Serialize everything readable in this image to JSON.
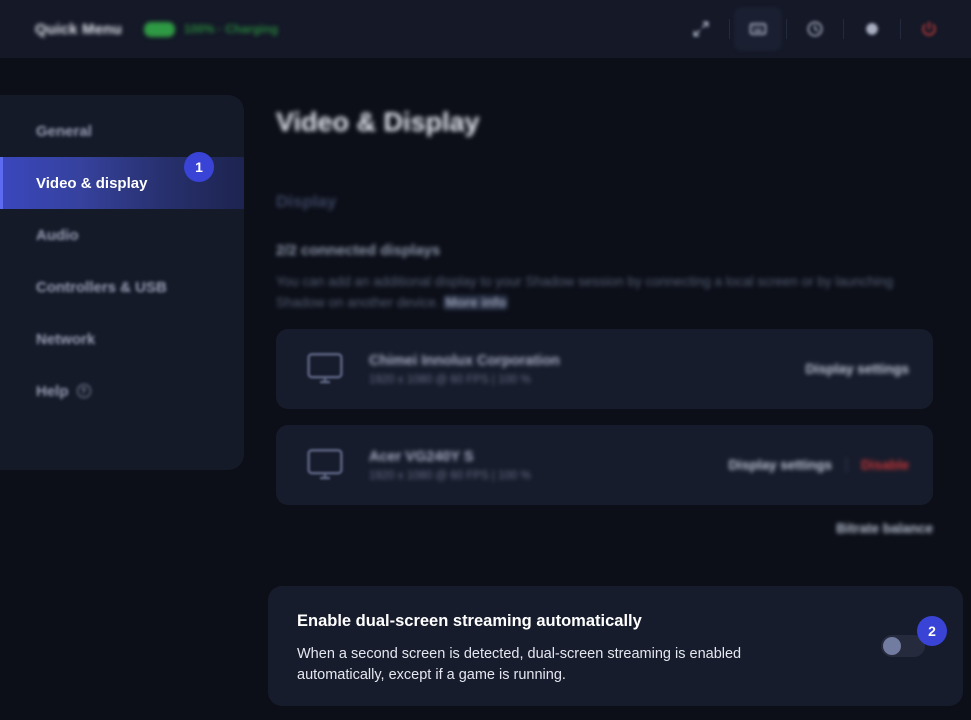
{
  "topbar": {
    "title": "Quick Menu",
    "battery_text": "100% · Charging",
    "battery_color": "#2f9a44",
    "icons": [
      {
        "name": "fullscreen-icon",
        "glyph": "⤢"
      },
      {
        "name": "keyboard-icon",
        "glyph": "⌨"
      },
      {
        "name": "refresh-icon",
        "glyph": "◷"
      },
      {
        "name": "settings-icon",
        "glyph": "⚙"
      },
      {
        "name": "power-icon",
        "glyph": "⏻"
      }
    ]
  },
  "sidebar": {
    "items": [
      {
        "label": "General",
        "active": false
      },
      {
        "label": "Video & display",
        "active": true
      },
      {
        "label": "Audio",
        "active": false
      },
      {
        "label": "Controllers & USB",
        "active": false
      },
      {
        "label": "Network",
        "active": false
      },
      {
        "label": "Help",
        "active": false,
        "help_icon": "?"
      }
    ],
    "active_accent": "#3a47bd"
  },
  "badges": {
    "one": "1",
    "two": "2",
    "color": "#3944d6"
  },
  "main": {
    "page_title": "Video & Display",
    "section_label": "Display",
    "connected_title": "2/2 connected displays",
    "connected_desc_1": "You can add an additional display to your Shadow session by connecting a local screen or by",
    "connected_desc_2": "launching Shadow on another device.",
    "more_info": "More info",
    "bitrate_link": "Bitrate balance",
    "displays": [
      {
        "name": "Chimei Innolux Corporation",
        "details": "1920 x 1080 @ 60 FPS  |  100 %",
        "settings_label": "Display settings",
        "disable_label": ""
      },
      {
        "name": "Acer VG240Y S",
        "details": "1920 x 1080 @ 60 FPS  |  100 %",
        "settings_label": "Display settings",
        "disable_label": "Disable"
      }
    ]
  },
  "dual_screen": {
    "title": "Enable dual-screen streaming automatically",
    "desc_line_1": "When a second screen is detected, dual-screen streaming is enabled",
    "desc_line_2": "automatically, except if a game is running.",
    "toggle_state": "off"
  }
}
